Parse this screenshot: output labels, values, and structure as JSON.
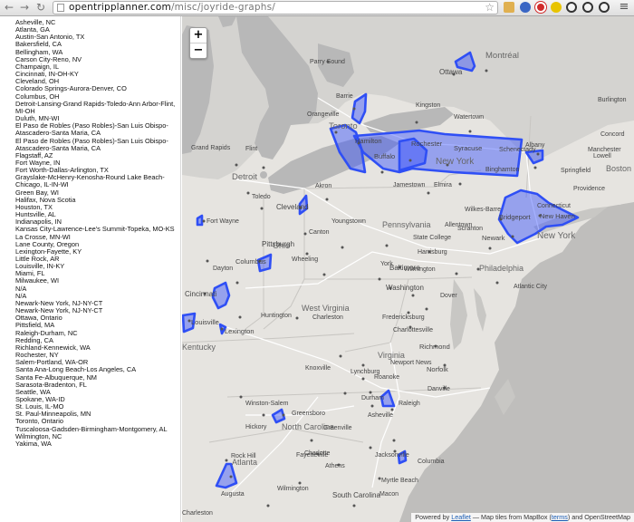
{
  "browser": {
    "url_host": "opentripplanner.com",
    "url_path": "/misc/joyride-graphs/"
  },
  "sidebar": {
    "cities": [
      "Asheville, NC",
      "Atlanta, GA",
      "Austin-San Antonio, TX",
      "Bakersfield, CA",
      "Bellingham, WA",
      "Carson City-Reno, NV",
      "Champaign, IL",
      "Cincinnati, IN-OH-KY",
      "Cleveland, OH",
      "Colorado Springs-Aurora-Denver, CO",
      "Columbus, OH",
      "Detroit-Lansing-Grand Rapids-Toledo-Ann Arbor-Flint, MI-OH",
      "Duluth, MN-WI",
      "El Paso de Robles (Paso Robles)-San Luis Obispo-Atascadero-Santa Maria, CA",
      "El Paso de Robles (Paso Robles)-San Luis Obispo-Atascadero-Santa Maria, CA",
      "Flagstaff, AZ",
      "Fort Wayne, IN",
      "Fort Worth-Dallas-Arlington, TX",
      "Grayslake-McHenry-Kenosha-Round Lake Beach-Chicago, IL-IN-WI",
      "Green Bay, WI",
      "Halifax, Nova Scotia",
      "Houston, TX",
      "Huntsville, AL",
      "Indianapolis, IN",
      "Kansas City-Lawrence-Lee's Summit-Topeka, MO-KS",
      "La Crosse, MN-WI",
      "Lane County, Oregon",
      "Lexington-Fayette, KY",
      "Little Rock, AR",
      "Louisville, IN-KY",
      "Miami, FL",
      "Milwaukee, WI",
      "N/A",
      "N/A",
      "Newark-New York, NJ-NY-CT",
      "Newark-New York, NJ-NY-CT",
      "Ottawa, Ontario",
      "Pittsfield, MA",
      "Raleigh-Durham, NC",
      "Redding, CA",
      "Richland-Kennewick, WA",
      "Rochester, NY",
      "Salem-Portland, WA-OR",
      "Santa Ana-Long Beach-Los Angeles, CA",
      "Santa Fe-Albuquerque, NM",
      "Sarasota-Bradenton, FL",
      "Seattle, WA",
      "Spokane, WA-ID",
      "St. Louis, IL-MO",
      "St. Paul-Minneapolis, MN",
      "Toronto, Ontario",
      "Tuscaloosa-Gadsden-Birmingham-Montgomery, AL",
      "Wilmington, NC",
      "Yakima, WA"
    ]
  },
  "map": {
    "zoom_in": "+",
    "zoom_out": "−",
    "attribution": {
      "prefix": "Powered by",
      "leaflet": "Leaflet",
      "middle": "— Map tiles from MapBox (",
      "terms": "terms",
      "suffix": ") and OpenStreetMap"
    },
    "labels": [
      {
        "text": "Ottawa",
        "size": 8
      },
      {
        "text": "Montréal",
        "size": 9.5
      },
      {
        "text": "Parry Sound",
        "size": 7
      },
      {
        "text": "Barrie",
        "size": 7
      },
      {
        "text": "Orangeville",
        "size": 7
      },
      {
        "text": "Kingston",
        "size": 7
      },
      {
        "text": "Watertown",
        "size": 7
      },
      {
        "text": "Toronto",
        "size": 9.5
      },
      {
        "text": "Hamilton",
        "size": 7.5
      },
      {
        "text": "Rochester",
        "size": 7.5
      },
      {
        "text": "Syracuse",
        "size": 7.5
      },
      {
        "text": "Buffalo",
        "size": 7.5
      },
      {
        "text": "New York",
        "size": 10
      },
      {
        "text": "Grand Rapids",
        "size": 7
      },
      {
        "text": "Flint",
        "size": 7
      },
      {
        "text": "Detroit",
        "size": 9.5
      },
      {
        "text": "Toledo",
        "size": 7
      },
      {
        "text": "Cleveland",
        "size": 8
      },
      {
        "text": "Akron",
        "size": 7
      },
      {
        "text": "Jamestown",
        "size": 7
      },
      {
        "text": "Elmira",
        "size": 7
      },
      {
        "text": "Binghamton",
        "size": 7
      },
      {
        "text": "Schenectady",
        "size": 7
      },
      {
        "text": "Albany",
        "size": 7
      },
      {
        "text": "Burlington",
        "size": 7
      },
      {
        "text": "Concord",
        "size": 7
      },
      {
        "text": "Manchester",
        "size": 7
      },
      {
        "text": "Lowell",
        "size": 7
      },
      {
        "text": "Boston",
        "size": 9
      },
      {
        "text": "Providence",
        "size": 7
      },
      {
        "text": "Springfield",
        "size": 7
      },
      {
        "text": "Connecticut",
        "size": 7
      },
      {
        "text": "Bridgeport",
        "size": 7.5
      },
      {
        "text": "New Haven",
        "size": 7.5
      },
      {
        "text": "New York",
        "size": 10
      },
      {
        "text": "Newark",
        "size": 7.5
      },
      {
        "text": "Wilkes-Barre",
        "size": 7
      },
      {
        "text": "Scranton",
        "size": 7
      },
      {
        "text": "Pennsylvania",
        "size": 9
      },
      {
        "text": "Fort Wayne",
        "size": 7
      },
      {
        "text": "Youngstown",
        "size": 7
      },
      {
        "text": "Canton",
        "size": 7
      },
      {
        "text": "State College",
        "size": 7
      },
      {
        "text": "Allentown",
        "size": 7
      },
      {
        "text": "Harrisburg",
        "size": 7
      },
      {
        "text": "York",
        "size": 7
      },
      {
        "text": "Wilmington",
        "size": 7
      },
      {
        "text": "Philadelphia",
        "size": 9
      },
      {
        "text": "Pittsburgh",
        "size": 8
      },
      {
        "text": "Ohio",
        "size": 9
      },
      {
        "text": "Dayton",
        "size": 7
      },
      {
        "text": "Columbus",
        "size": 7.5
      },
      {
        "text": "Wheeling",
        "size": 7
      },
      {
        "text": "Atlantic City",
        "size": 7
      },
      {
        "text": "Baltimore",
        "size": 8
      },
      {
        "text": "Cincinnati",
        "size": 8
      },
      {
        "text": "Washington",
        "size": 8
      },
      {
        "text": "Dover",
        "size": 7
      },
      {
        "text": "Huntington",
        "size": 7
      },
      {
        "text": "West Virginia",
        "size": 9
      },
      {
        "text": "Charleston",
        "size": 7
      },
      {
        "text": "Fredericksburg",
        "size": 7
      },
      {
        "text": "Louisville",
        "size": 7.5
      },
      {
        "text": "Lexington",
        "size": 7.5
      },
      {
        "text": "Charlottesville",
        "size": 7
      },
      {
        "text": "Richmond",
        "size": 7.5
      },
      {
        "text": "Kentucky",
        "size": 9
      },
      {
        "text": "Virginia",
        "size": 9
      },
      {
        "text": "Roanoke",
        "size": 7
      },
      {
        "text": "Lynchburg",
        "size": 7
      },
      {
        "text": "Newport News",
        "size": 7
      },
      {
        "text": "Norfolk",
        "size": 7.5
      },
      {
        "text": "Danville",
        "size": 7
      },
      {
        "text": "Knoxville",
        "size": 7
      },
      {
        "text": "Winston-Salem",
        "size": 7
      },
      {
        "text": "Greensboro",
        "size": 7
      },
      {
        "text": "Durham",
        "size": 7
      },
      {
        "text": "Raleigh",
        "size": 7
      },
      {
        "text": "Asheville",
        "size": 7
      },
      {
        "text": "Hickory",
        "size": 7
      },
      {
        "text": "North Carolina",
        "size": 9
      },
      {
        "text": "Greenville",
        "size": 7
      },
      {
        "text": "Charlotte",
        "size": 7
      },
      {
        "text": "Rock Hill",
        "size": 7
      },
      {
        "text": "Fayetteville",
        "size": 7
      },
      {
        "text": "Jacksonville",
        "size": 7
      },
      {
        "text": "Columbia",
        "size": 7
      },
      {
        "text": "Athens",
        "size": 7
      },
      {
        "text": "Atlanta",
        "size": 9
      },
      {
        "text": "Augusta",
        "size": 7
      },
      {
        "text": "South Carolina",
        "size": 8
      },
      {
        "text": "Wilmington",
        "size": 7
      },
      {
        "text": "Myrtle Beach",
        "size": 7
      },
      {
        "text": "Macon",
        "size": 7
      },
      {
        "text": "Charleston",
        "size": 7
      }
    ]
  }
}
